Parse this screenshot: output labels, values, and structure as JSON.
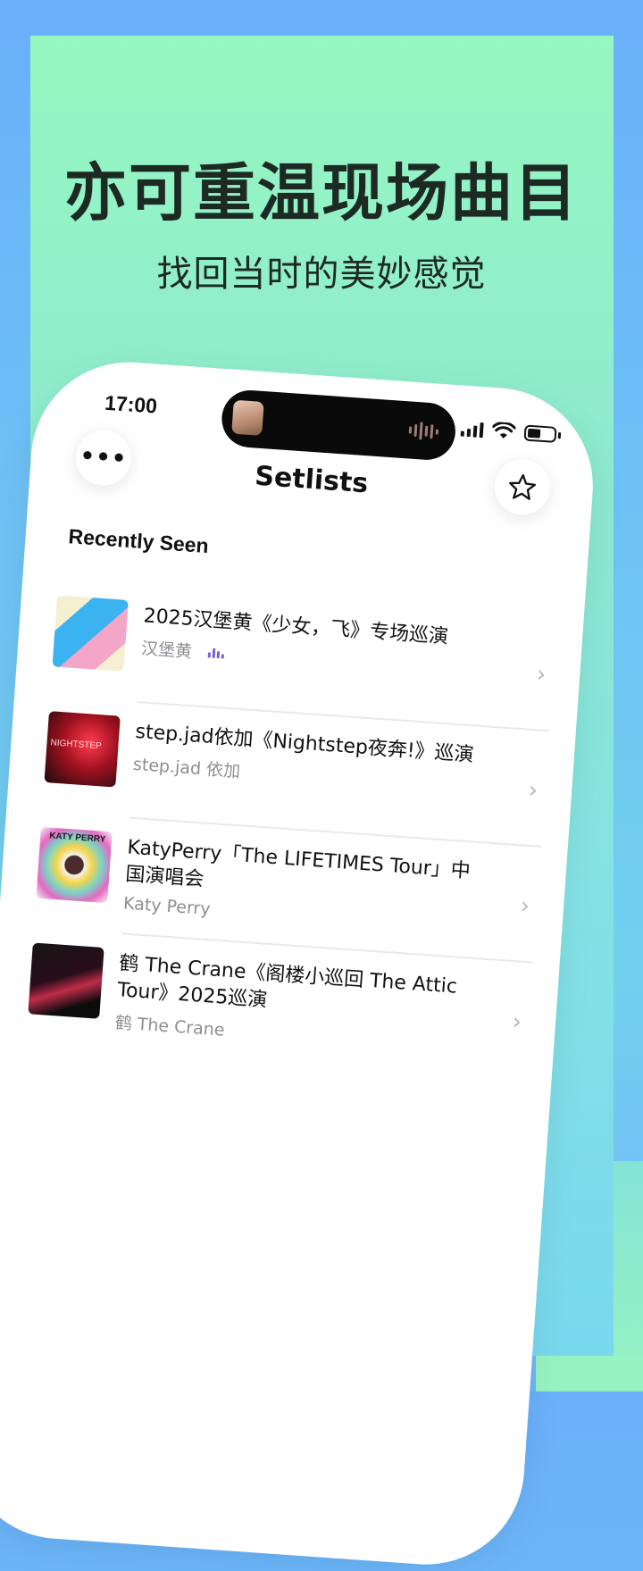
{
  "promo": {
    "headline": "亦可重温现场曲目",
    "subheadline": "找回当时的美妙感觉"
  },
  "status_bar": {
    "time": "17:00"
  },
  "nav": {
    "title": "Setlists",
    "more_label": "•••",
    "star_icon": "star-icon"
  },
  "section": {
    "title": "Recently Seen"
  },
  "items": [
    {
      "title": "2025汉堡黄《少女，飞》专场巡演",
      "subtitle": "汉堡黄",
      "playing": true
    },
    {
      "title": "step.jad依加《Nightstep夜奔!》巡演",
      "subtitle": "step.jad 依加",
      "thumb_text": "NIGHTSTEP"
    },
    {
      "title": "KatyPerry「The LIFETIMES Tour」中国演唱会",
      "subtitle": "Katy Perry",
      "thumb_text": "KATY PERRY"
    },
    {
      "title": "鹤 The Crane《阁楼小巡回 The Attic Tour》2025巡演",
      "subtitle": "鹤 The Crane"
    }
  ],
  "colors": {
    "accent_equalizer": "#7a63d9",
    "panel_green": "#96f7c1",
    "background_blue": "#6ab0fb"
  }
}
